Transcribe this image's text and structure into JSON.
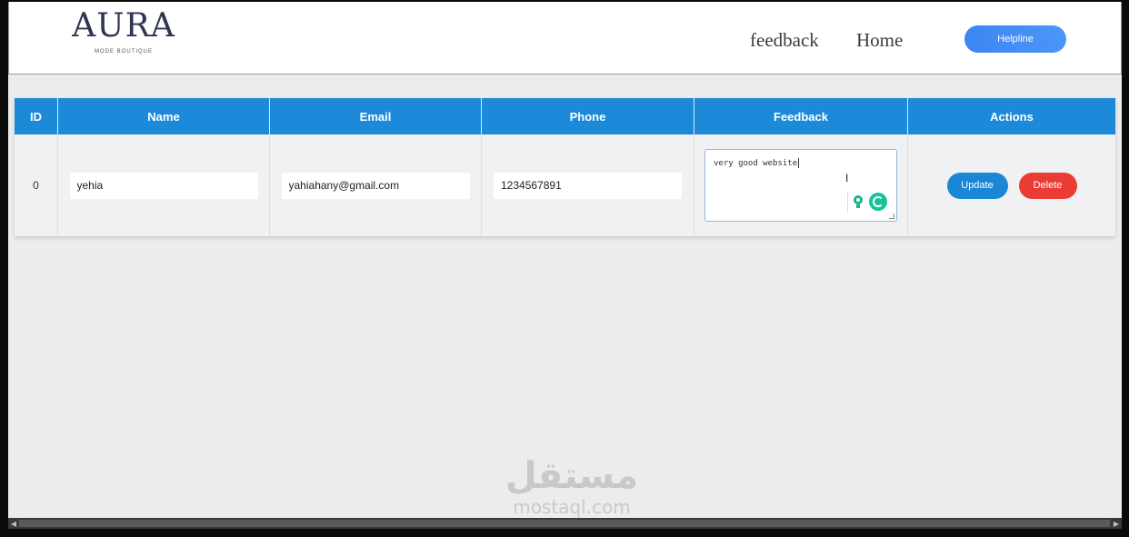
{
  "header": {
    "logo_text": "AURA",
    "logo_subtitle": "MODE BOUTIQUE",
    "nav": {
      "feedback": "feedback",
      "home": "Home"
    },
    "helpline_label": "Helpline"
  },
  "table": {
    "columns": [
      "ID",
      "Name",
      "Email",
      "Phone",
      "Feedback",
      "Actions"
    ],
    "rows": [
      {
        "id": "0",
        "name": "yehia",
        "email": "yahiahany@gmail.com",
        "phone": "1234567891",
        "feedback": "very good website",
        "update_label": "Update",
        "delete_label": "Delete"
      }
    ]
  },
  "watermark": {
    "arabic": "مستقل",
    "latin": "mostaql.com"
  },
  "colors": {
    "header_blue": "#1c8ad8",
    "update_blue": "#1c86d6",
    "delete_red": "#ea3b35",
    "helpline_blue": "#3d86f2"
  },
  "icons": [
    "bulb-icon",
    "grammar-assistant-icon",
    "text-cursor-icon",
    "resize-handle-icon",
    "scroll-left-arrow-icon",
    "scroll-right-arrow-icon"
  ]
}
